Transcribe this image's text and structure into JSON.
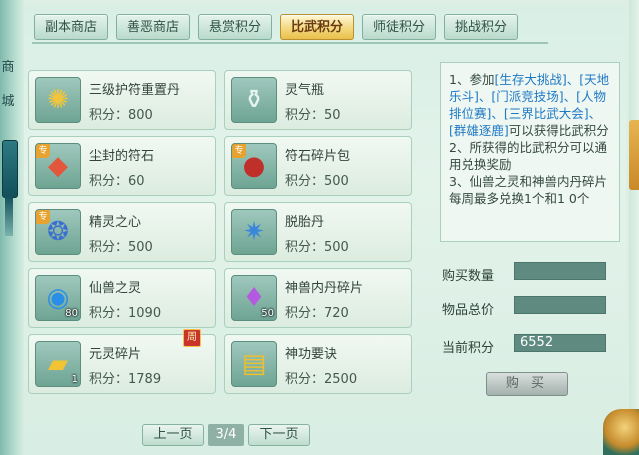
{
  "left_strip": {
    "char1": "商",
    "char2": "城"
  },
  "tabs": [
    {
      "label": "副本商店",
      "active": false
    },
    {
      "label": "善恶商店",
      "active": false
    },
    {
      "label": "悬赏积分",
      "active": false
    },
    {
      "label": "比武积分",
      "active": true
    },
    {
      "label": "师徒积分",
      "active": false
    },
    {
      "label": "挑战积分",
      "active": false
    }
  ],
  "items": [
    {
      "name": "三级护符重置丹",
      "points": "积分：800",
      "icon": "gold-pill-icon",
      "glyph": "✺",
      "special": false,
      "count": ""
    },
    {
      "name": "灵气瓶",
      "points": "积分：50",
      "icon": "spirit-bottle-icon",
      "glyph": "⚱",
      "special": false,
      "count": ""
    },
    {
      "name": "尘封的符石",
      "points": "积分：60",
      "icon": "rune-stone-icon",
      "glyph": "◆",
      "special": true,
      "special_label": "专",
      "count": ""
    },
    {
      "name": "符石碎片包",
      "points": "积分：500",
      "icon": "rune-bag-icon",
      "glyph": "●",
      "special": true,
      "special_label": "专",
      "count": ""
    },
    {
      "name": "精灵之心",
      "points": "积分：500",
      "icon": "elf-heart-icon",
      "glyph": "❂",
      "special": true,
      "special_label": "专",
      "count": ""
    },
    {
      "name": "脱胎丹",
      "points": "积分：500",
      "icon": "rebirth-pill-icon",
      "glyph": "✷",
      "special": false,
      "count": ""
    },
    {
      "name": "仙兽之灵",
      "points": "积分：1090",
      "icon": "beast-spirit-icon",
      "glyph": "◉",
      "special": false,
      "count": "80"
    },
    {
      "name": "神兽内丹碎片",
      "points": "积分：720",
      "icon": "beast-core-shard-icon",
      "glyph": "♦",
      "special": false,
      "count": "50"
    },
    {
      "name": "元灵碎片",
      "points": "积分：1789",
      "icon": "yuanling-shard-icon",
      "glyph": "▰",
      "special": false,
      "count": "1",
      "weekly": "周"
    },
    {
      "name": "神功要诀",
      "points": "积分：2500",
      "icon": "skill-book-icon",
      "glyph": "▤",
      "special": false,
      "count": ""
    }
  ],
  "pager": {
    "prev": "上一页",
    "page": "3/4",
    "next": "下一页"
  },
  "info": {
    "line1_a": "1、参加",
    "line1_links": "[生存大挑战]、[天地乐斗]、[门派竞技场]、[人物排位赛]、[三界比武大会]、[群雄逐鹿]",
    "line1_b": "可以获得比武积分",
    "line2": "2、所获得的比武积分可以通用兑换奖励",
    "line3": "3、仙兽之灵和神兽内丹碎片每周最多兑换1个和1 0个"
  },
  "form": {
    "quantity_label": "购买数量",
    "quantity_value": "",
    "total_label": "物品总价",
    "total_value": "",
    "current_label": "当前积分",
    "current_value": "6552"
  },
  "buy_button": "购 买",
  "colors": {
    "active_tab": "#f2d67a",
    "link": "#1f79c4",
    "field": "#5e8a80"
  }
}
